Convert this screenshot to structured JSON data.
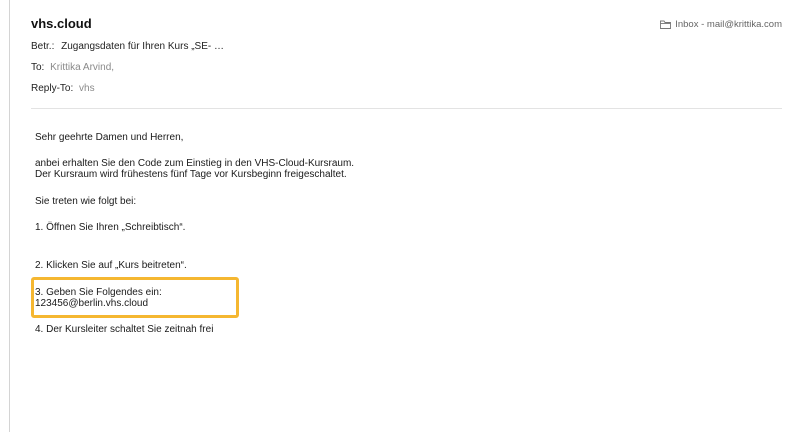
{
  "header": {
    "sender": "vhs.cloud",
    "mailbox": "Inbox - mail@krittika.com",
    "subject_label": "Betr.:",
    "subject": "Zugangsdaten für Ihren Kurs „SE- …",
    "to_label": "To:",
    "to": "Krittika Arvind,",
    "replyto_label": "Reply-To:",
    "replyto": "vhs"
  },
  "body": {
    "greeting": "Sehr geehrte Damen und Herren,",
    "intro_line1": "anbei erhalten Sie den Code zum Einstieg in den VHS-Cloud-Kursraum.",
    "intro_line2": "Der Kursraum wird frühestens fünf Tage vor Kursbeginn freigeschaltet.",
    "steps_intro": "Sie treten wie folgt bei:",
    "step1": "1. Öffnen Sie Ihren „Schreibtisch“.",
    "step2": "2. Klicken Sie auf „Kurs beitreten“.",
    "step3_line1": "3. Geben Sie Folgendes ein:",
    "step3_line2": "123456@berlin.vhs.cloud",
    "step4": "4. Der Kursleiter schaltet Sie zeitnah frei"
  },
  "colors": {
    "highlight": "#f5b731"
  }
}
